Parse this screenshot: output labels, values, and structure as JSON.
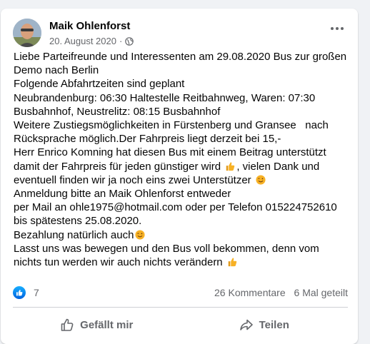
{
  "post": {
    "author": "Maik Ohlenforst",
    "date": "20. August 2020",
    "separator": "·",
    "audience_icon": "globe-icon",
    "menu_icon": "more-options-icon",
    "lines": [
      "Liebe Parteifreunde und Interessenten am 29.08.2020 Bus zur großen",
      "Demo nach Berlin",
      "Folgende Abfahrtzeiten sind geplant",
      "Neubrandenburg: 06:30 Haltestelle Reitbahnweg, Waren: 07:30",
      "Busbahnhof, Neustrelitz: 08:15 Busbahnhof",
      "Weitere Zustiegsmöglichkeiten in Fürstenberg und Gransee   nach",
      "Rücksprache möglich.Der Fahrpreis liegt derzeit bei 15,-",
      "Herr Enrico Komning hat diesen Bus mit einem Beitrag unterstützt",
      "damit der Fahrpreis für jeden günstiger wird",
      ", vielen Dank und",
      "eventuell finden wir ja noch eins zwei Unterstützer",
      "Anmeldung bitte an Maik Ohlenforst entweder",
      "per Mail an ohle1975@hotmail.com oder per Telefon 015224752610",
      "bis spätestens 25.08.2020.",
      "Bezahlung natürlich auch",
      "Lasst uns was bewegen und den Bus voll bekommen, denn vom",
      "nichts tun werden wir auch nichts verändern"
    ]
  },
  "stats": {
    "likes": "7",
    "comments": "26 Kommentare",
    "shares": "6 Mal geteilt"
  },
  "actions": {
    "like_label": "Gefällt mir",
    "share_label": "Teilen"
  },
  "colors": {
    "accent": "#1877f2",
    "secondary_text": "#65676b",
    "emoji_yellow": "#f7b125"
  }
}
